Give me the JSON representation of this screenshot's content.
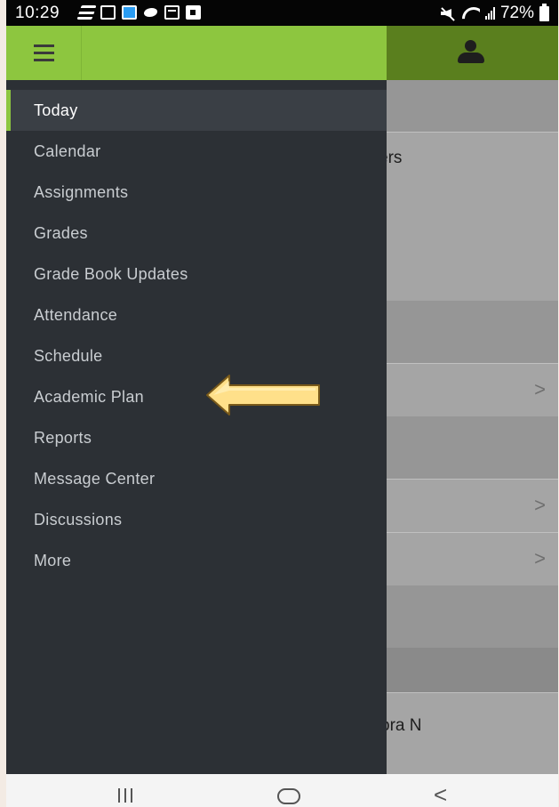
{
  "status_bar": {
    "time": "10:29",
    "battery_percent": "72%"
  },
  "header": {
    "menu_icon": "hamburger-icon",
    "profile_icon": "user-icon",
    "colors": {
      "primary": "#8dc63f",
      "dark": "#5a7f1e"
    }
  },
  "drawer": {
    "background": "#2c3035",
    "items": [
      {
        "label": "Today",
        "active": true
      },
      {
        "label": "Calendar",
        "active": false
      },
      {
        "label": "Assignments",
        "active": false
      },
      {
        "label": "Grades",
        "active": false
      },
      {
        "label": "Grade Book Updates",
        "active": false
      },
      {
        "label": "Attendance",
        "active": false
      },
      {
        "label": "Schedule",
        "active": false
      },
      {
        "label": "Academic Plan",
        "active": false
      },
      {
        "label": "Reports",
        "active": false
      },
      {
        "label": "Message Center",
        "active": false
      },
      {
        "label": "Discussions",
        "active": false
      },
      {
        "label": "More",
        "active": false
      }
    ]
  },
  "background_content": {
    "text_1": "ers",
    "text_2": "ora N",
    "chevron": ">"
  },
  "annotation": {
    "arrow_color": "#ffe08a",
    "points_to": "Academic Plan"
  },
  "nav_bar": {
    "back_glyph": "<"
  }
}
